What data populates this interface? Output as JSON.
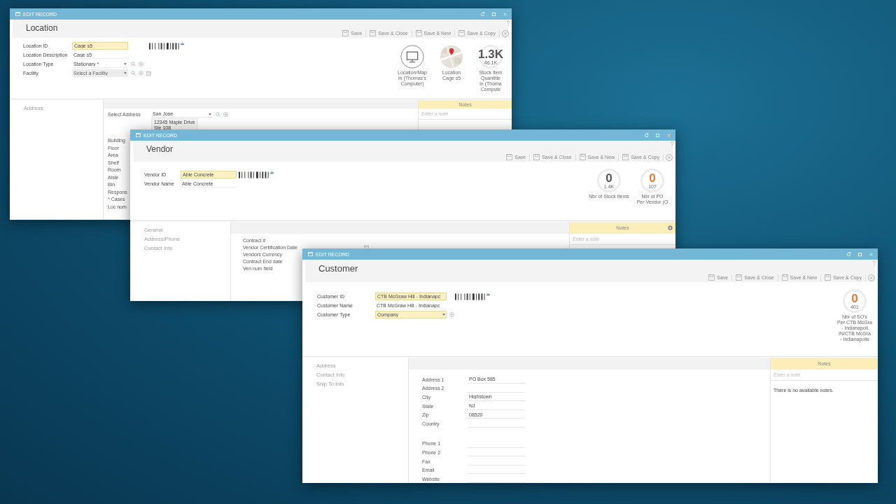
{
  "windows": [
    {
      "title_bar": "EDIT RECORD",
      "title": "Location",
      "toolbar": [
        "Save",
        "Save & Close",
        "Save & New",
        "Save & Copy"
      ],
      "fields": [
        {
          "label": "Location ID",
          "kind": "input",
          "value": "Cage s5",
          "highlighted": true,
          "barcode": true
        },
        {
          "label": "Location Description",
          "kind": "input",
          "value": "Cage s5",
          "highlighted": false
        },
        {
          "label": "Location Type",
          "kind": "select",
          "value": "Stationary *",
          "highlighted": false,
          "search_button": true,
          "add_button": true
        },
        {
          "label": "Facility",
          "kind": "select",
          "placeholder": "Select a Facility",
          "highlighted": false,
          "search_button": true,
          "add_button": true,
          "grid_button": true
        }
      ],
      "stats": [
        {
          "kind": "monitor",
          "caption": [
            "Location/Map",
            "in (Thomas's",
            "Computer)"
          ]
        },
        {
          "kind": "map",
          "caption": [
            "Location",
            "Cage s5"
          ]
        },
        {
          "kind": "number",
          "value": "1.3K",
          "sub": "46.1K",
          "color": "#555555",
          "caption": [
            "Stock Item",
            "Quantitie",
            "in (Thoma",
            "Compute"
          ]
        }
      ],
      "nav": [
        "Address"
      ],
      "section": [
        {
          "label": "Select Address",
          "kind": "select",
          "value": "San Jose",
          "search_button": true,
          "add_button": true
        },
        {
          "kind": "address",
          "lines": [
            "12345 Maple Drive",
            "Ste 108"
          ]
        },
        {
          "label": "Building",
          "kind": "label",
          "gap_before": true
        },
        {
          "label": "Floor",
          "kind": "label"
        },
        {
          "label": "Area",
          "kind": "label"
        },
        {
          "label": "Shelf",
          "kind": "label"
        },
        {
          "label": "Room",
          "kind": "label"
        },
        {
          "label": "Aisle",
          "kind": "label"
        },
        {
          "label": "Bin",
          "kind": "label"
        },
        {
          "label": "Respons",
          "kind": "label"
        },
        {
          "label": "* Cases",
          "kind": "label"
        },
        {
          "label": "Loc num",
          "kind": "label"
        }
      ],
      "notes": {
        "title": "Notes",
        "placeholder": "Enter a note"
      }
    },
    {
      "title_bar": "EDIT RECORD",
      "title": "Vendor",
      "toolbar": [
        "Save",
        "Save & Close",
        "Save & New",
        "Save & Copy"
      ],
      "fields": [
        {
          "label": "Vendor ID",
          "kind": "input",
          "value": "Able Concrete",
          "highlighted": true,
          "barcode": true
        },
        {
          "label": "Vendor Name",
          "kind": "input",
          "value": "Able Concrete",
          "highlighted": false
        }
      ],
      "stats": [
        {
          "kind": "number",
          "value": "0",
          "sub": "1.4K",
          "color": "#555555",
          "caption": [
            "Nbr of Stock Items"
          ]
        },
        {
          "kind": "number",
          "value": "0",
          "sub": "107",
          "color": "#e07b39",
          "caption": [
            "Nbr of PO",
            "Per Vendor (O"
          ]
        }
      ],
      "nav": [
        "General",
        "Address/Phone",
        "Contact Info"
      ],
      "section": [
        {
          "label": "Contract #",
          "kind": "label"
        },
        {
          "label": "Vendor Certification Date",
          "kind": "label",
          "calendar_button": true
        },
        {
          "label": "Vendors Currency",
          "kind": "label"
        },
        {
          "label": "Contract End date",
          "kind": "label"
        },
        {
          "label": "Ven num field",
          "kind": "label"
        }
      ],
      "notes": {
        "title": "Notes",
        "placeholder": "Enter a note",
        "add_button": true
      }
    },
    {
      "title_bar": "EDIT RECORD",
      "title": "Customer",
      "toolbar": [
        "Save",
        "Save & Close",
        "Save & New",
        "Save & Copy"
      ],
      "fields": [
        {
          "label": "Customer ID",
          "kind": "input",
          "value": "CTB McGraw Hill - Indianapc",
          "highlighted": true,
          "barcode": true
        },
        {
          "label": "Customer Name",
          "kind": "input",
          "value": "CTB McGraw Hill - Indianapc",
          "highlighted": false
        },
        {
          "label": "Customer Type",
          "kind": "select",
          "value": "Company",
          "highlighted": true,
          "add_button": true
        }
      ],
      "stats": [
        {
          "kind": "number",
          "value": "0",
          "sub": "401",
          "color": "#e07b39",
          "caption": [
            "Nbr of SO's",
            "Per CTB McGra",
            "- Indianapoli",
            "IN/CTB McGra",
            "- Indianapolis"
          ]
        }
      ],
      "nav": [
        "Address",
        "Contact Info",
        "Ship To Info"
      ],
      "section": [
        {
          "label": "Address 1",
          "kind": "input",
          "value": "PO Box 585"
        },
        {
          "label": "Address 2",
          "kind": "input"
        },
        {
          "label": "City",
          "kind": "input",
          "value": "Highstown"
        },
        {
          "label": "State",
          "kind": "input",
          "value": "NJ"
        },
        {
          "label": "Zip",
          "kind": "input",
          "value": "08520"
        },
        {
          "label": "Country",
          "kind": "input"
        },
        {
          "label": "Phone 1",
          "kind": "input",
          "gap_before": true
        },
        {
          "label": "Phone 2",
          "kind": "input"
        },
        {
          "label": "Fax",
          "kind": "input"
        },
        {
          "label": "Email",
          "kind": "input"
        },
        {
          "label": "Website",
          "kind": "input"
        }
      ],
      "notes": {
        "title": "Notes",
        "placeholder": "Enter a note",
        "message": "There is no available notes."
      }
    }
  ]
}
